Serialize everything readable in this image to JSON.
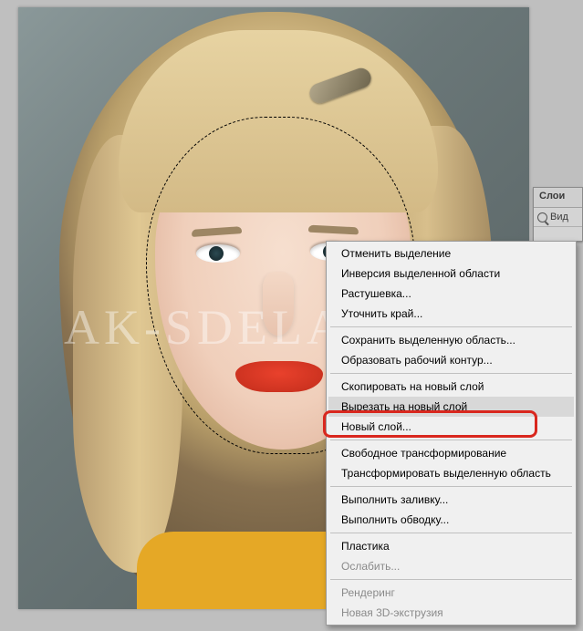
{
  "watermark": "AK-SDELAT.ORG",
  "layers_panel": {
    "tab_label": "Слои",
    "search_label": "Вид"
  },
  "context_menu": {
    "items": [
      {
        "label": "Отменить выделение",
        "disabled": false
      },
      {
        "label": "Инверсия выделенной области",
        "disabled": false
      },
      {
        "label": "Растушевка...",
        "disabled": false
      },
      {
        "label": "Уточнить край...",
        "disabled": false
      }
    ],
    "items2": [
      {
        "label": "Сохранить выделенную область...",
        "disabled": false
      },
      {
        "label": "Образовать рабочий контур...",
        "disabled": false
      }
    ],
    "items3": [
      {
        "label": "Скопировать на новый слой",
        "disabled": false
      },
      {
        "label": "Вырезать на новый слой",
        "disabled": false,
        "hover": true
      },
      {
        "label": "Новый слой...",
        "disabled": false
      }
    ],
    "items4": [
      {
        "label": "Свободное трансформирование",
        "disabled": false
      },
      {
        "label": "Трансформировать выделенную область",
        "disabled": false
      }
    ],
    "items5": [
      {
        "label": "Выполнить заливку...",
        "disabled": false
      },
      {
        "label": "Выполнить обводку...",
        "disabled": false
      }
    ],
    "items6": [
      {
        "label": "Пластика",
        "disabled": false
      },
      {
        "label": "Ослабить...",
        "disabled": true
      }
    ],
    "items7": [
      {
        "label": "Рендеринг",
        "disabled": true
      },
      {
        "label": "Новая 3D-экструзия",
        "disabled": true
      }
    ]
  }
}
